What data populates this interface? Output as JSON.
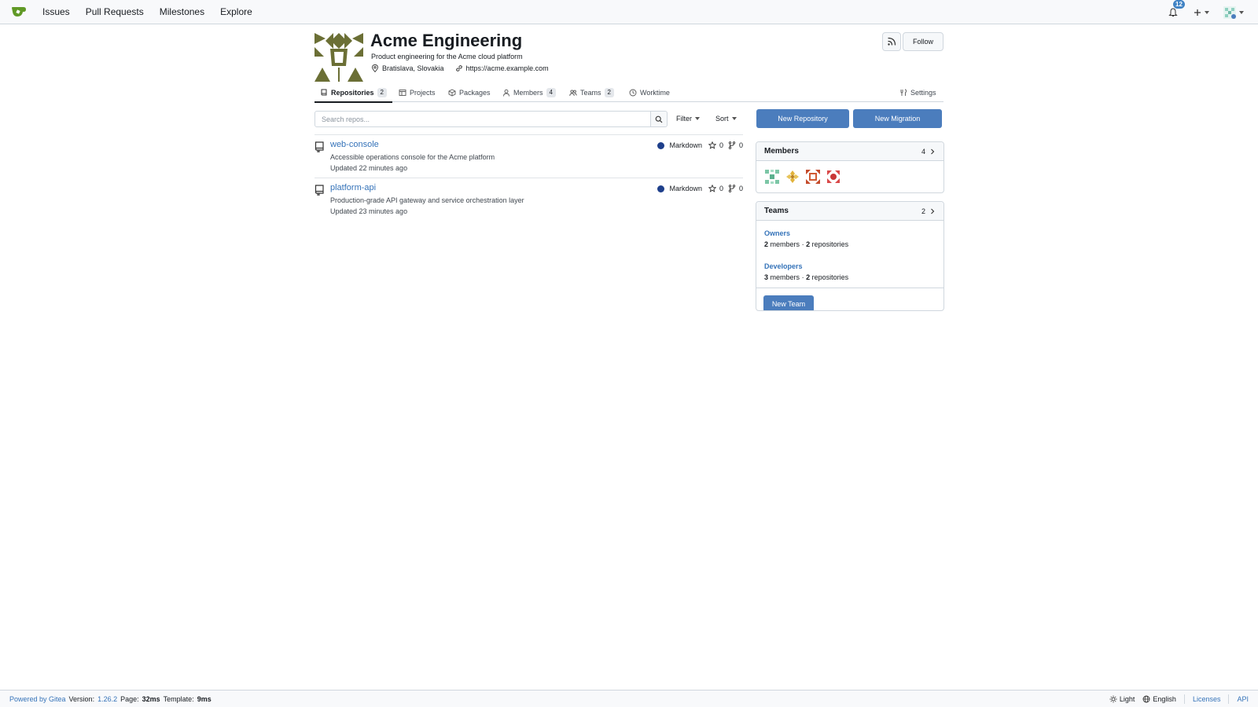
{
  "navbar": {
    "items": [
      "Issues",
      "Pull Requests",
      "Milestones",
      "Explore"
    ],
    "notification_count": "12"
  },
  "org": {
    "name": "Acme Engineering",
    "description": "Product engineering for the Acme cloud platform",
    "location": "Bratislava, Slovakia",
    "website": "https://acme.example.com",
    "follow_label": "Follow",
    "avatar_color": "#6b6f35"
  },
  "tabs": [
    {
      "label": "Repositories",
      "count": "2",
      "active": true
    },
    {
      "label": "Projects"
    },
    {
      "label": "Packages"
    },
    {
      "label": "Members",
      "count": "4"
    },
    {
      "label": "Teams",
      "count": "2"
    },
    {
      "label": "Worktime"
    },
    {
      "label": "Settings"
    }
  ],
  "search": {
    "placeholder": "Search repos...",
    "filter_label": "Filter",
    "sort_label": "Sort"
  },
  "actions": {
    "new_repository": "New Repository",
    "new_migration": "New Migration"
  },
  "repos": [
    {
      "name": "web-console",
      "description": "Accessible operations console for the Acme platform",
      "updated": "Updated 22 minutes ago",
      "language": "Markdown",
      "language_color": "#1e3f8b",
      "stars": "0",
      "forks": "0"
    },
    {
      "name": "platform-api",
      "description": "Production-grade API gateway and service orchestration layer",
      "updated": "Updated 23 minutes ago",
      "language": "Markdown",
      "language_color": "#1e3f8b",
      "stars": "0",
      "forks": "0"
    }
  ],
  "members_card": {
    "title": "Members",
    "count": "4"
  },
  "teams_card": {
    "title": "Teams",
    "count": "2",
    "teams": [
      {
        "name": "Owners",
        "members": "2",
        "members_label": "members",
        "sep": "·",
        "repos": "2",
        "repos_label": "repositories"
      },
      {
        "name": "Developers",
        "members": "3",
        "members_label": "members",
        "sep": "·",
        "repos": "2",
        "repos_label": "repositories"
      }
    ],
    "new_team_label": "New Team"
  },
  "footer": {
    "powered_by": "Powered by Gitea",
    "version_label": "Version:",
    "version": "1.26.2",
    "page_label": "Page:",
    "page_time": "32ms",
    "template_label": "Template:",
    "template_time": "9ms",
    "theme": "Light",
    "language": "English",
    "licenses": "Licenses",
    "api": "API"
  },
  "colors": {
    "accent": "#4b7dbd",
    "link": "#3573b9",
    "logo_green": "#609926"
  }
}
